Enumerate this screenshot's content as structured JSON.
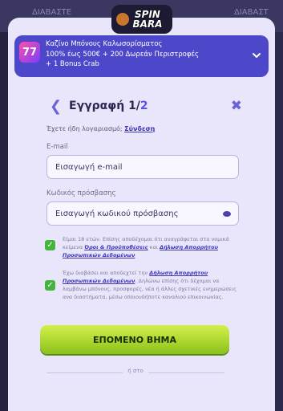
{
  "background": {
    "tabs": [
      "ΔΙΑΒΑΣΤΕ",
      "ΔΙΑΒΑΣΤ"
    ]
  },
  "logo": {
    "text_top": "SPIN",
    "text_bottom": "BARA"
  },
  "banner": {
    "icon_text": "77",
    "line1": "Καζίνο Μπόνους Καλωσορίσματος",
    "line2": "100% έως 500€ + 200 Δωρεάν Περιστροφές",
    "line3": "+ 1 Bonus Crab"
  },
  "form": {
    "title": "Εγγραφή 1/",
    "title_step": "2",
    "login_prompt": "Έχετε ήδη λογαριασμό;",
    "login_link": "Σύνδεση",
    "email_label": "E-mail",
    "email_placeholder": "Εισαγωγή e-mail",
    "password_label": "Κωδικός πρόσβασης",
    "password_placeholder": "Εισαγωγή κωδικού πρόσβασης",
    "consent1_text": "Είμαι 18 ετών. Επίσης αποδέχομαι ότι αναγράφεται στα νομικά κείμενα",
    "consent1_link1": "Όροι & Προϋποθέσεις",
    "consent1_and": "και",
    "consent1_link2": "Δήλωση Απορρήτου Προσωπικών Δεδομένων",
    "consent2_prefix": "Έχω διαβάσει και αποδεχτεί την",
    "consent2_link": "Δήλωση Απορρήτου Προσωπικών Δεδομένων",
    "consent2_text": ". Δηλώνω επίσης ότι δέχομαι να λαμβάνω μπόνους, προσφορές, νέα ή άλλες σχετικές ενημερώσεις ανα διαστήματα, μέσω οποιουδήποτε καναλιού επικοινωνίας.",
    "next_button": "ΕΠΟΜΕΝΟ ΒΗΜΑ",
    "or_text": "ή στο"
  },
  "colors": {
    "accent": "#5c53e0",
    "cta": "#b6e035",
    "checkbox": "#44b43f",
    "banner": "#4d48c9"
  }
}
